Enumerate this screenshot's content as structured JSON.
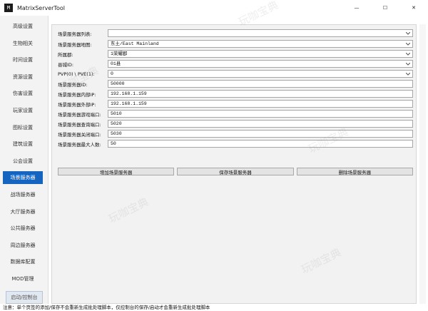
{
  "window": {
    "title": "MatrixServerTool",
    "icon_text": "M",
    "controls": {
      "minimize": "—",
      "maximize": "☐",
      "close": "✕"
    }
  },
  "sidebar": {
    "items": [
      {
        "label": "高级设置"
      },
      {
        "label": "生物相关"
      },
      {
        "label": "时间设置"
      },
      {
        "label": "资源设置"
      },
      {
        "label": "伤害设置"
      },
      {
        "label": "玩家设置"
      },
      {
        "label": "图标设置"
      },
      {
        "label": "建筑设置"
      },
      {
        "label": "公会设置"
      },
      {
        "label": "场景服务器",
        "active": true
      },
      {
        "label": "战场服务器"
      },
      {
        "label": "大厅服务器"
      },
      {
        "label": "公共服务器"
      },
      {
        "label": "周边服务器"
      },
      {
        "label": "数据库配置"
      },
      {
        "label": "MOD管理"
      },
      {
        "label": "启动/控制台"
      }
    ]
  },
  "form": {
    "rows": [
      {
        "label": "场景服务器列表:",
        "type": "combo",
        "value": ""
      },
      {
        "label": "场景服务器地图:",
        "type": "combo",
        "value": "东土/East Mainland"
      },
      {
        "label": "所属郡:",
        "type": "combo",
        "value": "1荣耀郡"
      },
      {
        "label": "县城ID:",
        "type": "combo",
        "value": "01县"
      },
      {
        "label": "PVP(0) \\ PVE(1):",
        "type": "combo",
        "value": "0"
      },
      {
        "label": "场景服务器ID:",
        "type": "text",
        "value": "50000"
      },
      {
        "label": "场景服务器内部IP:",
        "type": "text",
        "value": "192.168.1.159"
      },
      {
        "label": "场景服务器外部IP:",
        "type": "text",
        "value": "192.168.1.159"
      },
      {
        "label": "场景服务器游戏端口:",
        "type": "text",
        "value": "5010"
      },
      {
        "label": "场景服务器查询端口:",
        "type": "text",
        "value": "5020"
      },
      {
        "label": "场景服务器关闭端口:",
        "type": "text",
        "value": "5030"
      },
      {
        "label": "场景服务器最大人数:",
        "type": "text",
        "value": "50"
      }
    ],
    "buttons": {
      "add": "增加场景服务器",
      "save": "保存场景服务器",
      "delete": "删除场景服务器"
    }
  },
  "status": {
    "text": "注意：单个页签的添加/保存不会重新生成批处理脚本，仅控制台的保存/启动才会重新生成批处理脚本"
  },
  "watermark": {
    "text": "玩咖宝典"
  },
  "colors": {
    "accent": "#1565c0",
    "panel": "#f2f2f2",
    "sidebar": "#f3f3f3"
  }
}
